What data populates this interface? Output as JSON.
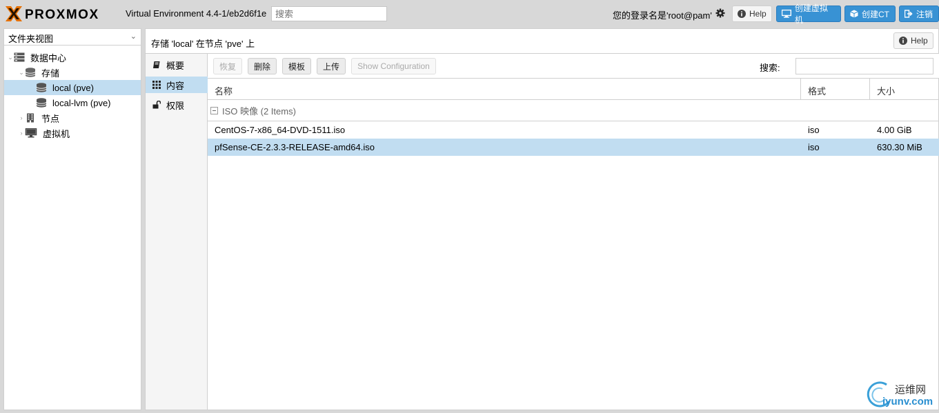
{
  "topbar": {
    "version": "Virtual Environment 4.4-1/eb2d6f1e",
    "search_placeholder": "搜索",
    "login_text": "您的登录名是'root@pam'",
    "help_label": "Help",
    "create_vm_label": "创建虚拟机",
    "create_ct_label": "创建CT",
    "logout_label": "注销"
  },
  "tree": {
    "view_label": "文件夹视图",
    "items": [
      {
        "label": "数据中心"
      },
      {
        "label": "存储"
      },
      {
        "label": "local (pve)"
      },
      {
        "label": "local-lvm (pve)"
      },
      {
        "label": "节点"
      },
      {
        "label": "虚拟机"
      }
    ]
  },
  "main": {
    "title": "存储 'local' 在节点 'pve' 上",
    "help_label": "Help"
  },
  "nav": {
    "items": [
      {
        "label": "概要"
      },
      {
        "label": "内容"
      },
      {
        "label": "权限"
      }
    ]
  },
  "toolbar": {
    "restore_label": "恢复",
    "delete_label": "删除",
    "template_label": "模板",
    "upload_label": "上传",
    "show_config_label": "Show Configuration",
    "search_label": "搜索:"
  },
  "grid": {
    "columns": [
      "名称",
      "格式",
      "大小"
    ],
    "group_label": "ISO 映像 (2 Items)",
    "rows": [
      {
        "name": "CentOS-7-x86_64-DVD-1511.iso",
        "format": "iso",
        "size": "4.00 GiB"
      },
      {
        "name": "pfSense-CE-2.3.3-RELEASE-amd64.iso",
        "format": "iso",
        "size": "630.30 MiB"
      }
    ]
  },
  "watermark": {
    "line1": "运维网",
    "line2": "iyunv.com"
  },
  "colors": {
    "accent": "#3892d4",
    "selection": "#c1ddf1",
    "logo_orange": "#e57000"
  }
}
